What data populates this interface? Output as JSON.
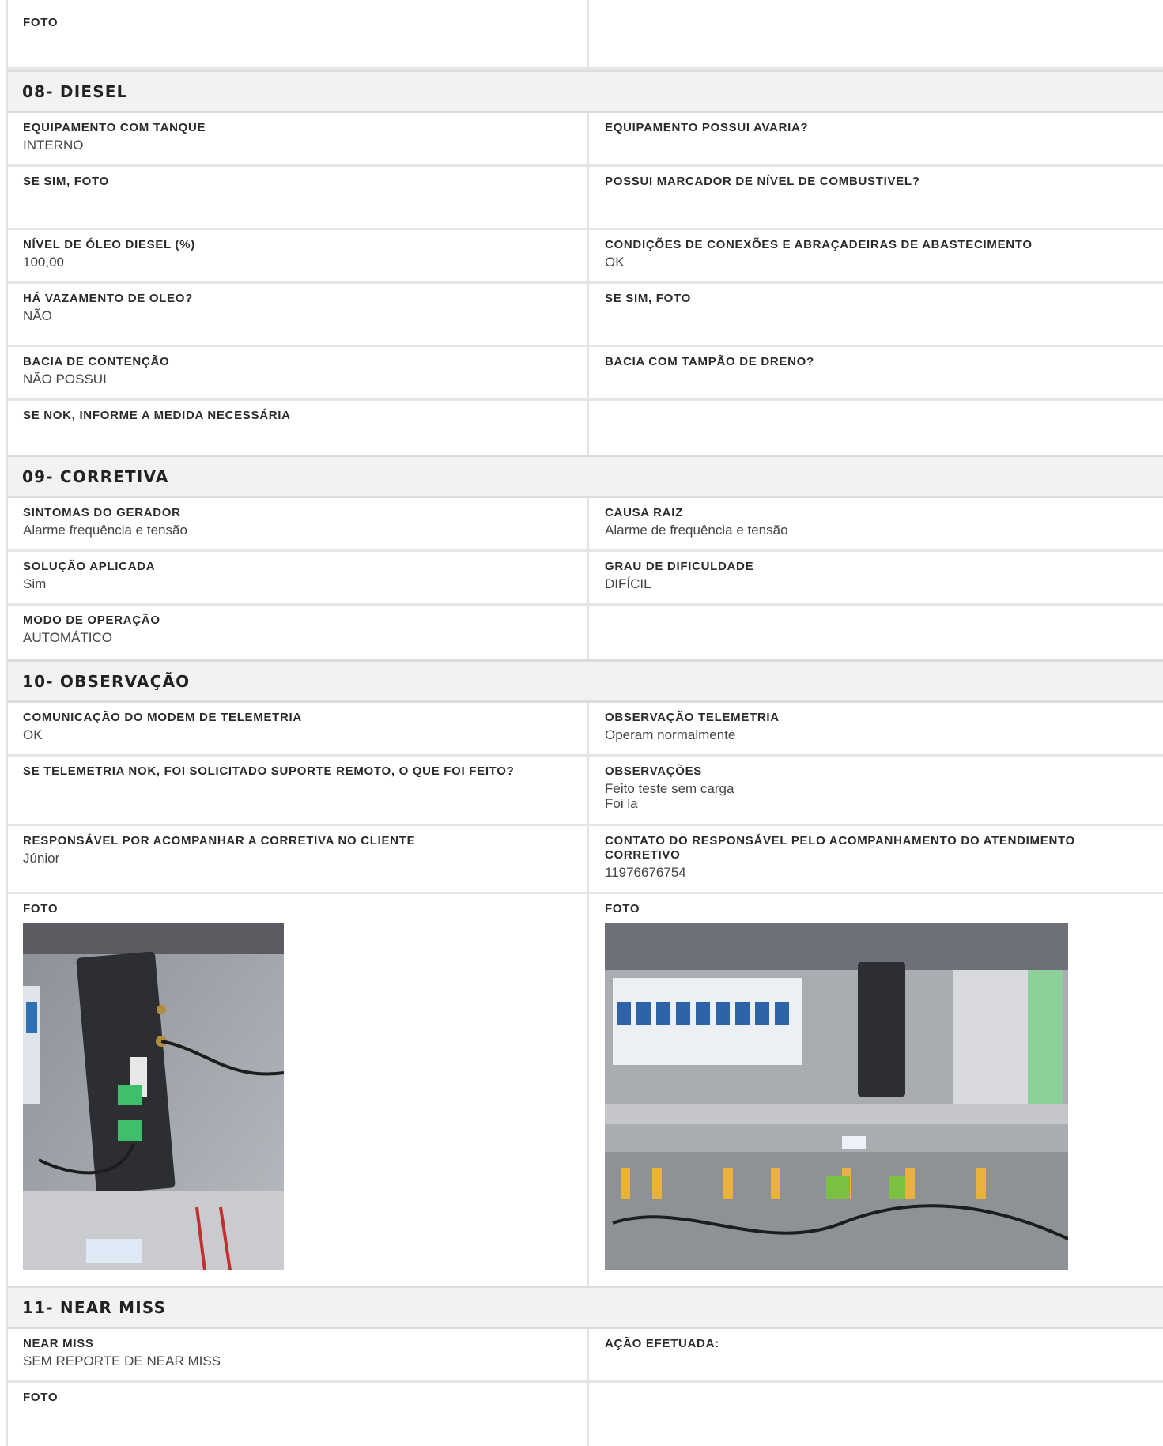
{
  "top": {
    "left_label": "FOTO"
  },
  "diesel": {
    "title": "08- DIESEL",
    "equip_tanque_label": "EQUIPAMENTO COM TANQUE",
    "equip_tanque_value": "INTERNO",
    "avaria_label": "EQUIPAMENTO POSSUI AVARIA?",
    "se_sim_foto_label": "SE SIM, FOTO",
    "marcador_label": "POSSUI MARCADOR DE NÍVEL DE COMBUSTIVEL?",
    "nivel_label": "NÍVEL DE ÓLEO DIESEL (%)",
    "nivel_value": "100,00",
    "conexoes_label": "CONDIÇÕES DE CONEXÕES E ABRAÇADEIRAS DE ABASTECIMENTO",
    "conexoes_value": "OK",
    "vazamento_label": "HÁ VAZAMENTO DE OLEO?",
    "vazamento_value": "NÃO",
    "se_sim_foto2_label": "SE SIM, FOTO",
    "bacia_label": "BACIA DE CONTENÇÃO",
    "bacia_value": "NÃO POSSUI",
    "tampao_label": "BACIA COM TAMPÃO DE DRENO?",
    "se_nok_label": "SE NOK, INFORME A MEDIDA NECESSÁRIA"
  },
  "corretiva": {
    "title": "09- CORRETIVA",
    "sintomas_label": "SINTOMAS DO GERADOR",
    "sintomas_value": "Alarme frequência e tensão",
    "causa_label": "CAUSA RAIZ",
    "causa_value": "Alarme de frequência e tensão",
    "solucao_label": "SOLUÇÃO APLICADA",
    "solucao_value": "Sim",
    "grau_label": "GRAU DE DIFICULDADE",
    "grau_value": "DIFÍCIL",
    "modo_label": "MODO DE OPERAÇÃO",
    "modo_value": "AUTOMÁTICO"
  },
  "observacao": {
    "title": "10- OBSERVAÇÃO",
    "modem_label": "COMUNICAÇÃO DO MODEM DE TELEMETRIA",
    "modem_value": "OK",
    "obs_tele_label": "OBSERVAÇÃO TELEMETRIA",
    "obs_tele_value": "Operam normalmente",
    "suporte_label": "SE TELEMETRIA NOK, FOI SOLICITADO SUPORTE REMOTO, O QUE FOI FEITO?",
    "obs_label": "OBSERVAÇÕES",
    "obs_line1": "Feito teste sem carga",
    "obs_line2": "Foi la",
    "resp_label": "RESPONSÁVEL POR ACOMPANHAR A CORRETIVA NO CLIENTE",
    "resp_value": "Júnior",
    "contato_label_1": "CONTATO DO RESPONSÁVEL PELO ACOMPANHAMENTO DO ATENDIMENTO",
    "contato_label_2": "CORRETIVO",
    "contato_value": "11976676754",
    "foto_left_label": "FOTO",
    "foto_right_label": "FOTO"
  },
  "near_miss": {
    "title": "11- NEAR MISS",
    "near_label": "NEAR MISS",
    "near_value": "SEM REPORTE DE NEAR MISS",
    "acao_label": "AÇÃO EFETUADA:",
    "foto_label": "FOTO"
  },
  "colors": {
    "header_bg": "#f2f2f2",
    "border": "#e3e3e3",
    "text": "#333333"
  }
}
